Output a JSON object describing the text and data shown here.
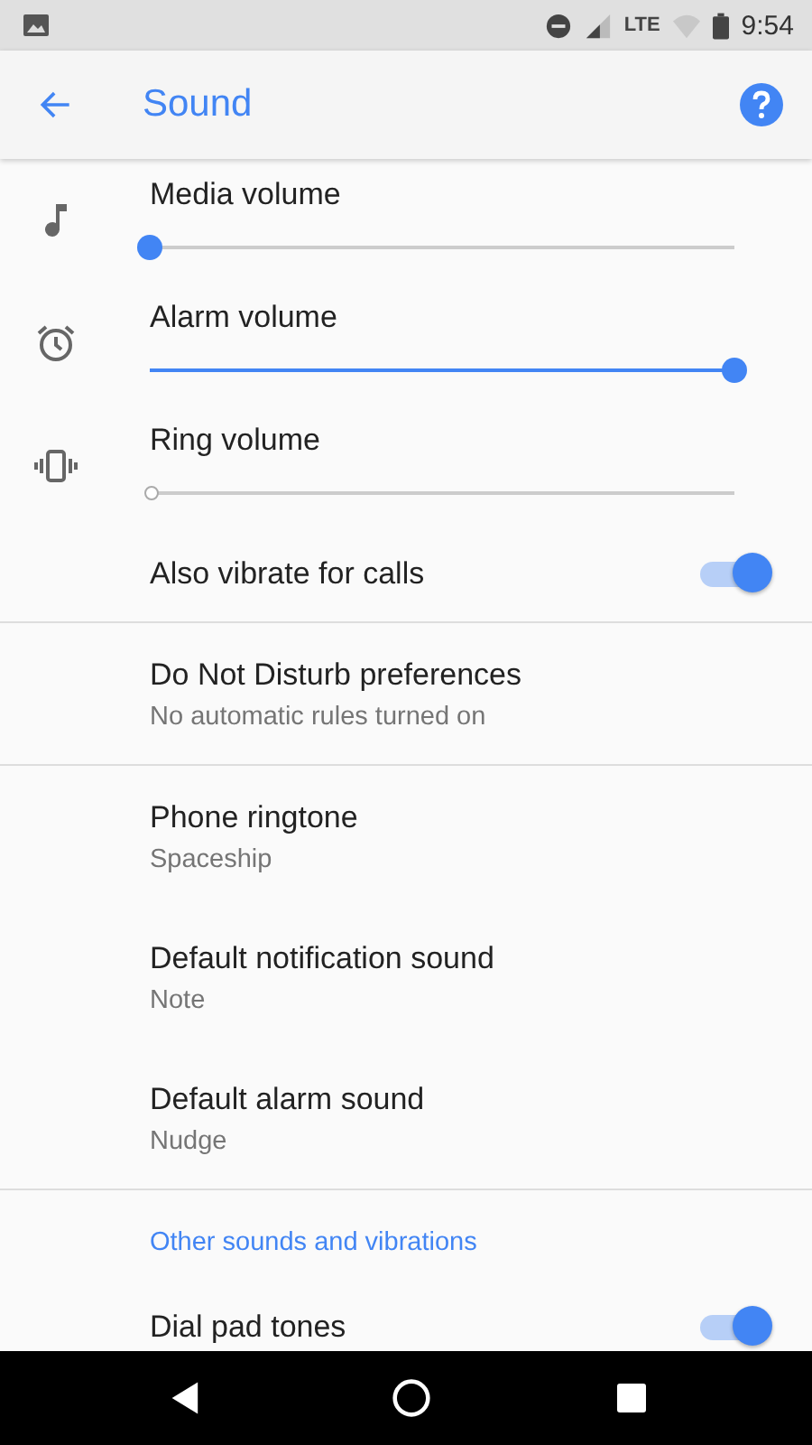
{
  "status_bar": {
    "time": "9:54",
    "network": "LTE"
  },
  "app_bar": {
    "title": "Sound"
  },
  "sections": [
    {
      "items": [
        {
          "kind": "slider",
          "title": "Media volume",
          "level": 0,
          "muted": false
        },
        {
          "kind": "slider",
          "title": "Alarm volume",
          "level": 1,
          "muted": false
        },
        {
          "kind": "slider",
          "title": "Ring volume",
          "level": 0,
          "muted": true
        },
        {
          "kind": "switch",
          "title": "Also vibrate for calls",
          "on": true
        }
      ]
    },
    {
      "items": [
        {
          "kind": "link",
          "title": "Do Not Disturb preferences",
          "summary": "No automatic rules turned on"
        }
      ]
    },
    {
      "items": [
        {
          "kind": "link",
          "title": "Phone ringtone",
          "summary": "Spaceship"
        },
        {
          "kind": "link",
          "title": "Default notification sound",
          "summary": "Note"
        },
        {
          "kind": "link",
          "title": "Default alarm sound",
          "summary": "Nudge"
        }
      ]
    },
    {
      "items": [
        {
          "kind": "header",
          "title": "Other sounds and vibrations"
        },
        {
          "kind": "switch",
          "title": "Dial pad tones",
          "on": true
        }
      ]
    }
  ]
}
